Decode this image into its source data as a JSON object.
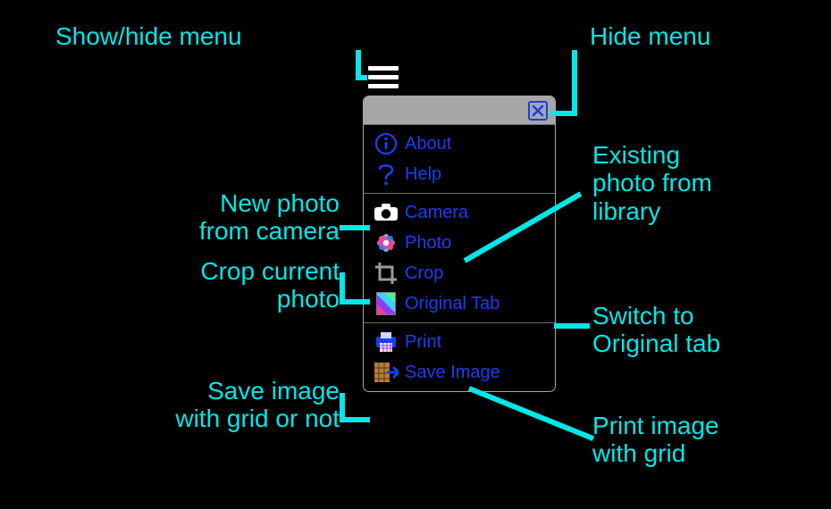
{
  "colors": {
    "accent": "#00e8e8",
    "menu_text": "#1a3ef0",
    "header_bg": "#a7a7a7"
  },
  "hamburger_name": "menu-toggle",
  "annotations": {
    "show_hide": "Show/hide menu",
    "hide_menu": "Hide menu",
    "new_photo_l1": "New photo",
    "new_photo_l2": "from camera",
    "crop_l1": "Crop current",
    "crop_l2": "photo",
    "save_l1": "Save image",
    "save_l2": "with grid or not",
    "existing_l1": "Existing",
    "existing_l2": "photo from",
    "existing_l3": "library",
    "switch_l1": "Switch to",
    "switch_l2": "Original tab",
    "print_l1": "Print image",
    "print_l2": "with grid"
  },
  "menu": {
    "section1": [
      {
        "icon": "info-icon",
        "label": "About"
      },
      {
        "icon": "help-icon",
        "label": "Help"
      }
    ],
    "section2": [
      {
        "icon": "camera-icon",
        "label": "Camera"
      },
      {
        "icon": "photos-icon",
        "label": "Photo"
      },
      {
        "icon": "crop-icon",
        "label": "Crop"
      },
      {
        "icon": "original-tab-icon",
        "label": "Original Tab"
      }
    ],
    "section3": [
      {
        "icon": "print-icon",
        "label": "Print"
      },
      {
        "icon": "save-image-icon",
        "label": "Save Image"
      }
    ]
  }
}
